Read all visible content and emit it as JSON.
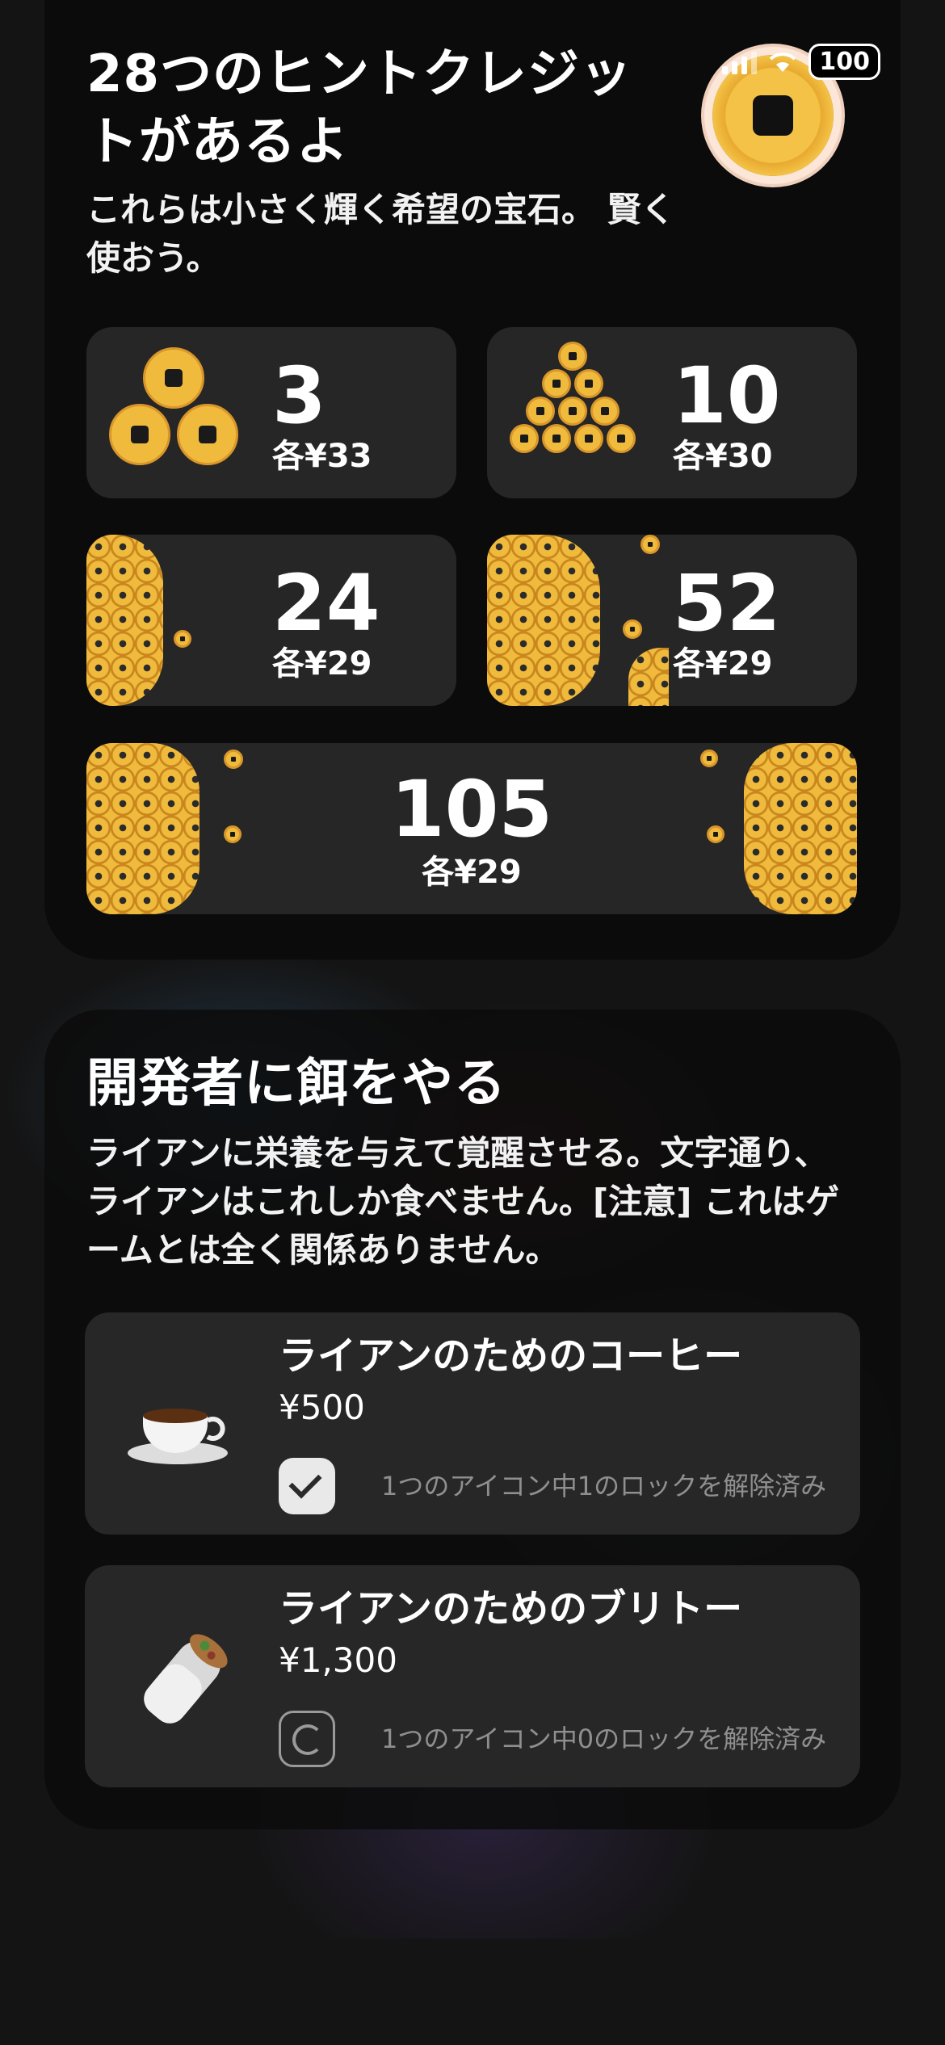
{
  "status_bar": {
    "battery": "100",
    "wifi_icon": "wifi-icon",
    "signal_icon": "signal-icon"
  },
  "hints": {
    "title": "28つのヒントクレジットがあるよ",
    "subtitle": "これらは小さく輝く希望の宝石。 賢く使おう。",
    "packs": [
      {
        "count": "3",
        "price": "各¥33"
      },
      {
        "count": "10",
        "price": "各¥30"
      },
      {
        "count": "24",
        "price": "各¥29"
      },
      {
        "count": "52",
        "price": "各¥29"
      },
      {
        "count": "105",
        "price": "各¥29"
      }
    ]
  },
  "feed": {
    "title": "開発者に餌をやる",
    "description": "ライアンに栄養を与えて覚醒させる。文字通り、ライアンはこれしか食べません。[注意] これはゲームとは全く関係ありません。",
    "items": [
      {
        "name": "ライアンのためのコーヒー",
        "price": "¥500",
        "status": "1つのアイコン中1のロックを解除済み",
        "icon": "coffee-cup-icon"
      },
      {
        "name": "ライアンのためのブリトー",
        "price": "¥1,300",
        "status": "1つのアイコン中0のロックを解除済み",
        "icon": "burrito-icon"
      }
    ]
  },
  "colors": {
    "coin": "#f0bb3c",
    "panel": "#0b0b0b",
    "tile": "#262626"
  }
}
